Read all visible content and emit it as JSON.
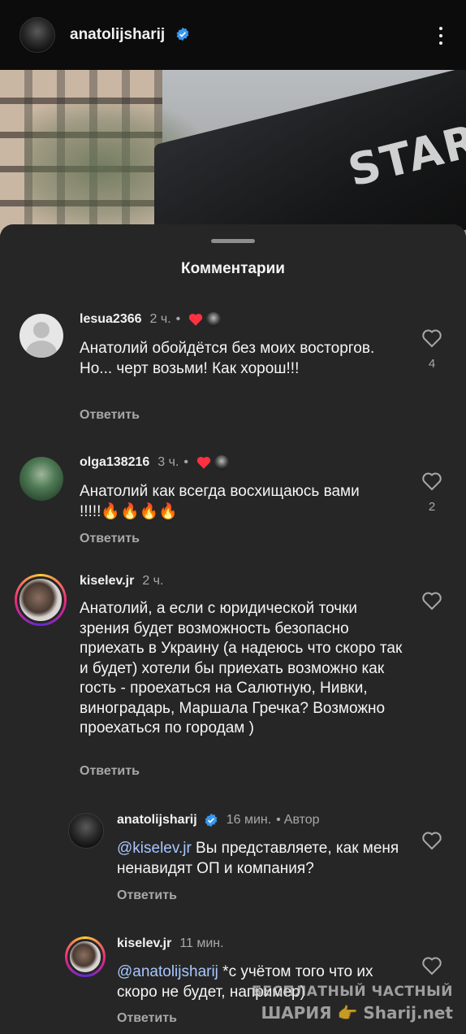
{
  "post": {
    "username": "anatolijsharij",
    "verified": true,
    "image_text": "STAR"
  },
  "sheet": {
    "title": "Комментарии"
  },
  "comments": [
    {
      "username": "lesua2366",
      "time": "2 ч.",
      "meta_dot": "•",
      "liked_by_author": true,
      "text": "Анатолий обойдётся без моих восторгов. Но... черт возьми! Как хорош!!!",
      "reply_label": "Ответить",
      "like_count": "4"
    },
    {
      "username": "olga138216",
      "time": "3 ч.",
      "meta_dot": "•",
      "liked_by_author": true,
      "text": "Анатолий как всегда восхищаюсь вами !!!!!🔥🔥🔥🔥",
      "reply_label": "Ответить",
      "like_count": "2"
    },
    {
      "username": "kiselev.jr",
      "time": "2 ч.",
      "liked_by_author": false,
      "text": "Анатолий, а если с юридической точки зрения будет возможность безопасно приехать в Украину (а надеюсь что скоро так и будет) хотели бы приехать возможно как гость - проехаться на Салютную, Нивки, виноградарь, Маршала Гречка? Возможно проехаться по городам )",
      "reply_label": "Ответить",
      "like_count": ""
    }
  ],
  "replies": [
    {
      "username": "anatolijsharij",
      "verified": true,
      "time": "16 мин.",
      "meta_dot": "•",
      "author_label": "Автор",
      "mention": "@kiselev.jr",
      "text": " Вы представляете, как меня ненавидят ОП и компания?",
      "reply_label": "Ответить"
    },
    {
      "username": "kiselev.jr",
      "time": "11 мин.",
      "mention": "@anatolijsharij",
      "text": " *с учётом того что их скоро не будет, например)",
      "reply_label": "Ответить"
    }
  ],
  "watermark": {
    "line1": "БЕСПЛАТНЫЙ ЧАСТНЫЙ",
    "line2_left": "ШАРИЯ",
    "line2_right": "Sharij.net",
    "pointer": "👉"
  },
  "colors": {
    "sheet_bg": "#262626",
    "like_red": "#ff3040",
    "verified_blue": "#3897f0",
    "mention_blue": "#a7c7ff",
    "secondary_text": "#a8a8a8"
  },
  "icons": [
    "verified-badge-icon",
    "kebab-menu-icon",
    "heart-outline-icon",
    "heart-filled-icon"
  ]
}
